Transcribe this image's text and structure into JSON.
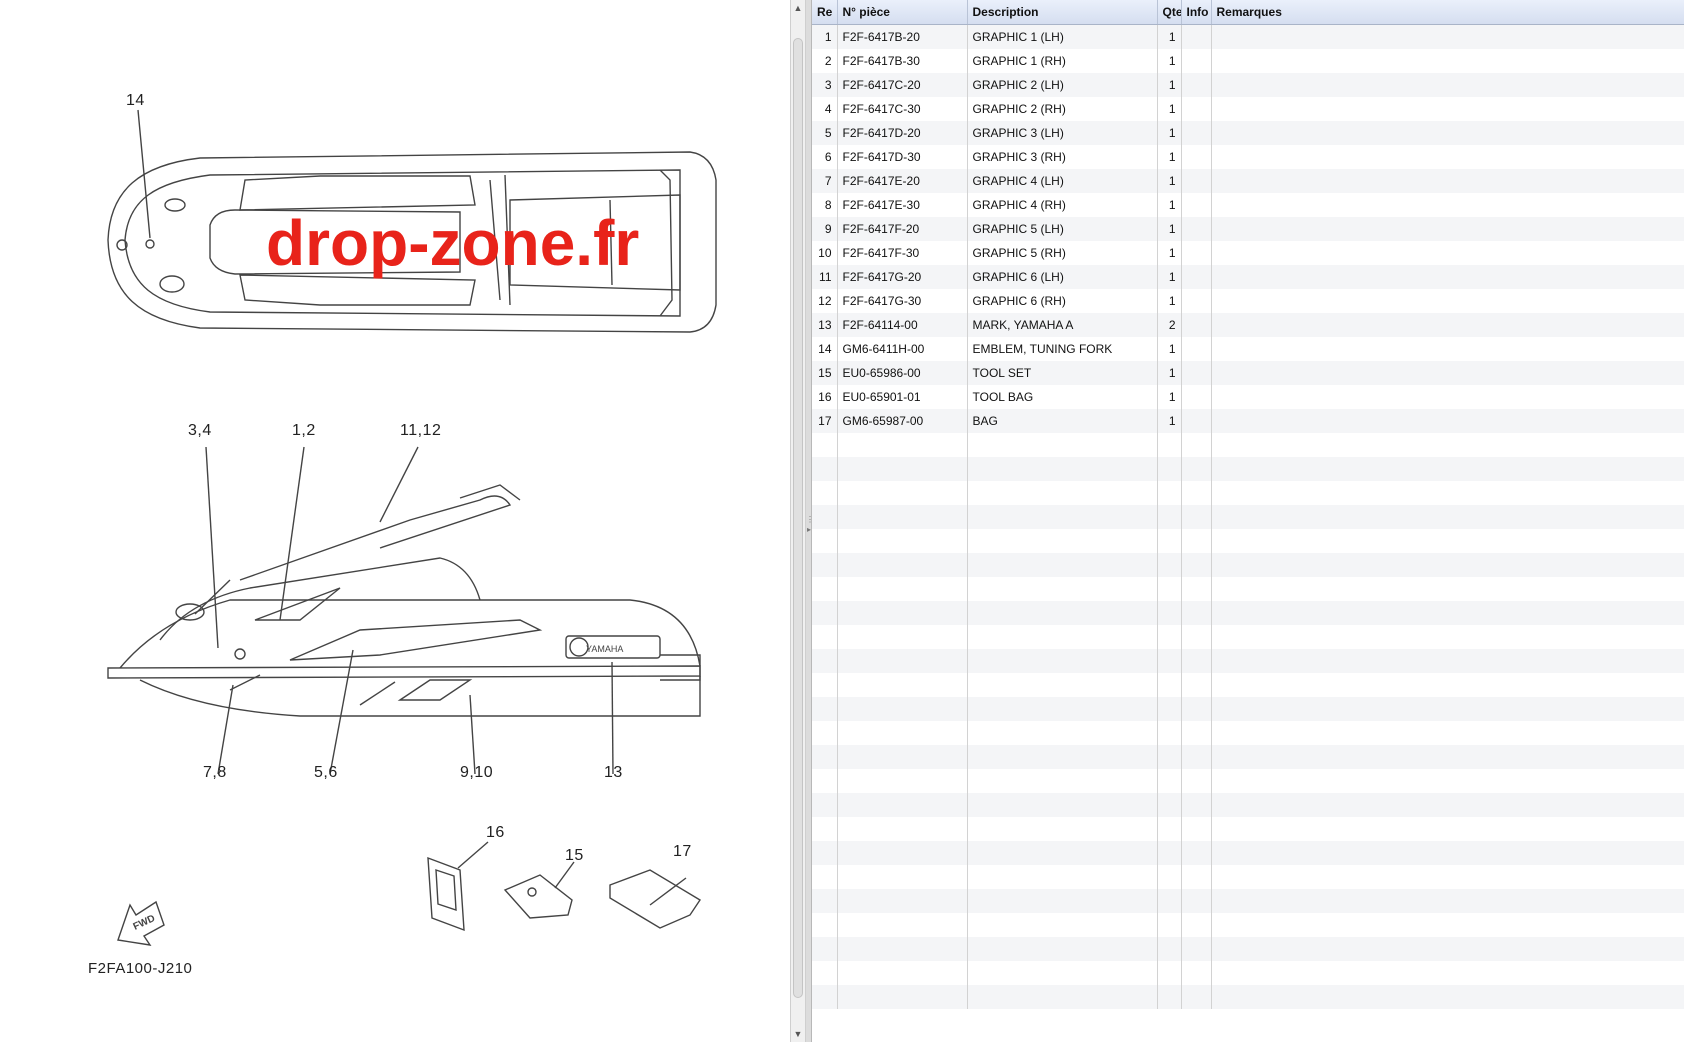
{
  "diagram": {
    "watermark": "drop-zone.fr",
    "code": "F2FA100-J210",
    "fwd_label": "FWD",
    "brand_on_hull": "YAMAHA",
    "callouts": {
      "c14": "14",
      "c34": "3,4",
      "c12": "1,2",
      "c1112": "11,12",
      "c78": "7,8",
      "c56": "5,6",
      "c910": "9,10",
      "c13": "13",
      "c16": "16",
      "c15": "15",
      "c17": "17"
    }
  },
  "table": {
    "columns": {
      "ref": "Re",
      "part": "N° pièce",
      "description": "Description",
      "qty": "Qte",
      "info": "Info",
      "remarks": "Remarques"
    },
    "rows": [
      {
        "ref": "1",
        "part": "F2F-6417B-20",
        "description": "GRAPHIC 1 (LH)",
        "qty": "1"
      },
      {
        "ref": "2",
        "part": "F2F-6417B-30",
        "description": "GRAPHIC 1 (RH)",
        "qty": "1"
      },
      {
        "ref": "3",
        "part": "F2F-6417C-20",
        "description": "GRAPHIC 2 (LH)",
        "qty": "1"
      },
      {
        "ref": "4",
        "part": "F2F-6417C-30",
        "description": "GRAPHIC 2 (RH)",
        "qty": "1"
      },
      {
        "ref": "5",
        "part": "F2F-6417D-20",
        "description": "GRAPHIC 3 (LH)",
        "qty": "1"
      },
      {
        "ref": "6",
        "part": "F2F-6417D-30",
        "description": "GRAPHIC 3 (RH)",
        "qty": "1"
      },
      {
        "ref": "7",
        "part": "F2F-6417E-20",
        "description": "GRAPHIC 4 (LH)",
        "qty": "1"
      },
      {
        "ref": "8",
        "part": "F2F-6417E-30",
        "description": "GRAPHIC 4 (RH)",
        "qty": "1"
      },
      {
        "ref": "9",
        "part": "F2F-6417F-20",
        "description": "GRAPHIC 5 (LH)",
        "qty": "1"
      },
      {
        "ref": "10",
        "part": "F2F-6417F-30",
        "description": "GRAPHIC 5 (RH)",
        "qty": "1"
      },
      {
        "ref": "11",
        "part": "F2F-6417G-20",
        "description": "GRAPHIC 6 (LH)",
        "qty": "1"
      },
      {
        "ref": "12",
        "part": "F2F-6417G-30",
        "description": "GRAPHIC 6 (RH)",
        "qty": "1"
      },
      {
        "ref": "13",
        "part": "F2F-64114-00",
        "description": "MARK, YAMAHA A",
        "qty": "2"
      },
      {
        "ref": "14",
        "part": "GM6-6411H-00",
        "description": "EMBLEM, TUNING FORK",
        "qty": "1"
      },
      {
        "ref": "15",
        "part": "EU0-65986-00",
        "description": "TOOL SET",
        "qty": "1"
      },
      {
        "ref": "16",
        "part": "EU0-65901-01",
        "description": "TOOL BAG",
        "qty": "1"
      },
      {
        "ref": "17",
        "part": "GM6-65987-00",
        "description": "BAG",
        "qty": "1"
      }
    ],
    "empty_rows": 24
  }
}
